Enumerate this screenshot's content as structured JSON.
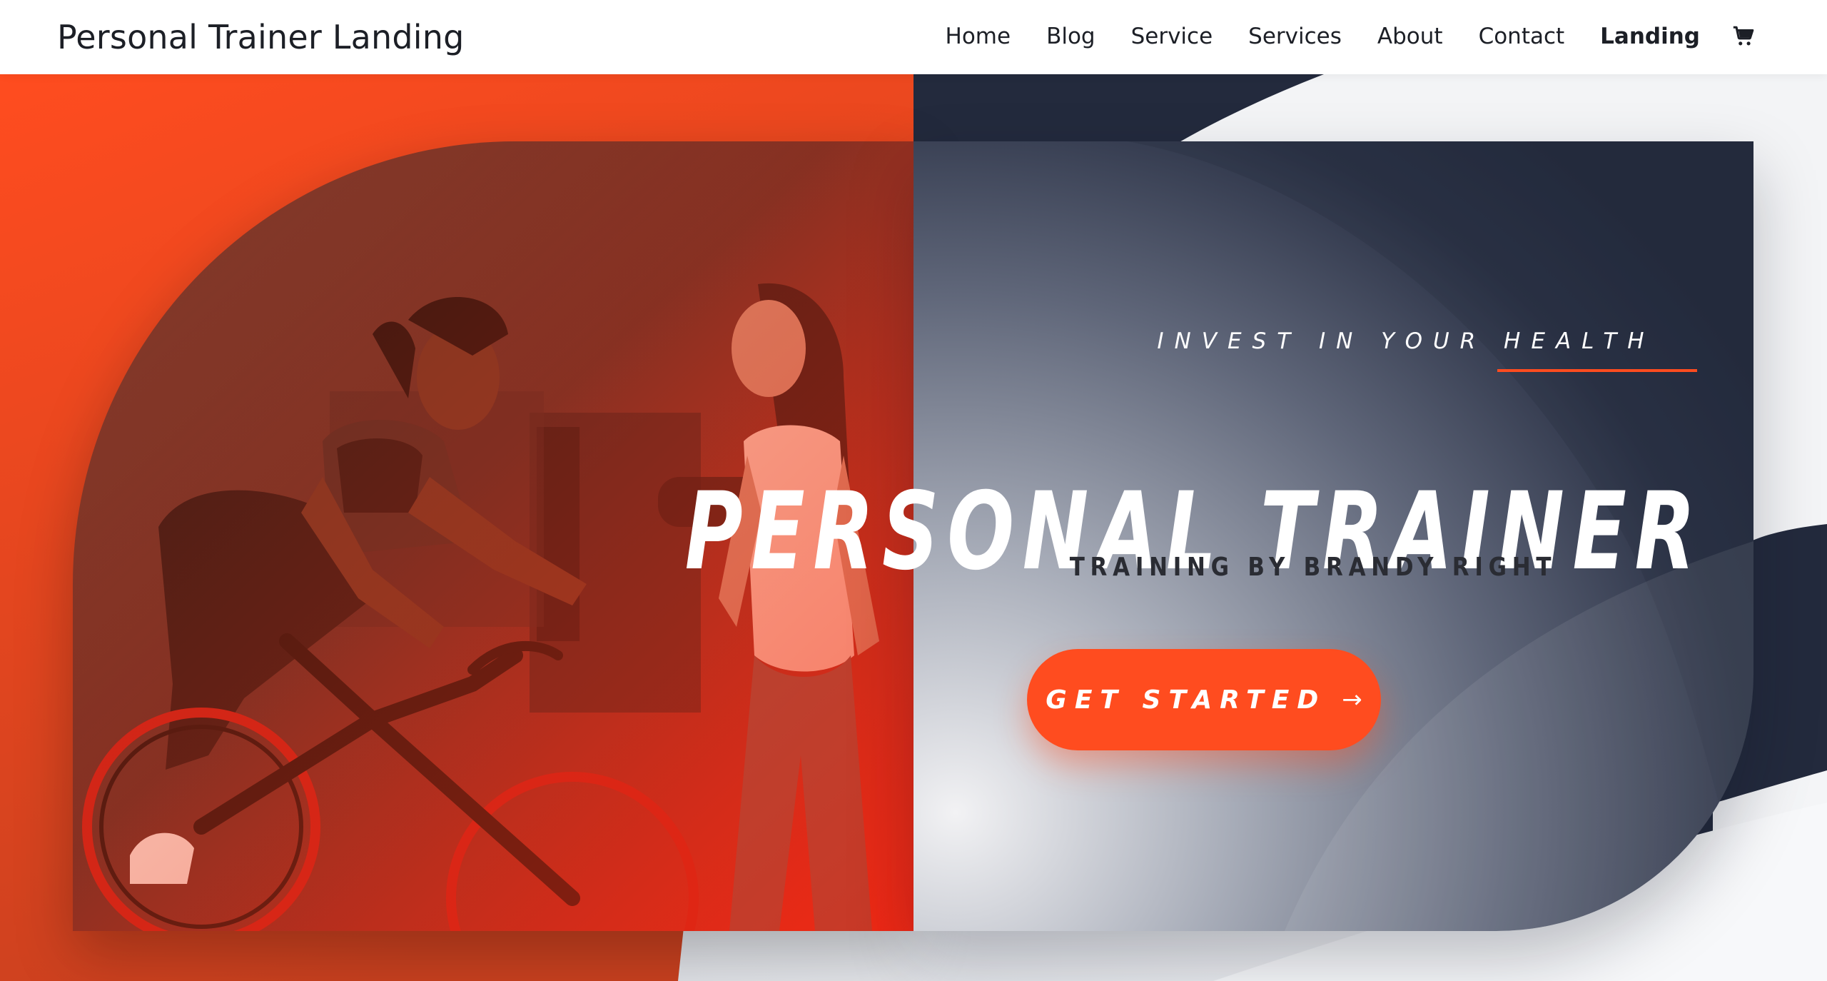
{
  "header": {
    "site_title": "Personal Trainer Landing",
    "nav": [
      {
        "label": "Home"
      },
      {
        "label": "Blog"
      },
      {
        "label": "Service"
      },
      {
        "label": "Services"
      },
      {
        "label": "About"
      },
      {
        "label": "Contact"
      },
      {
        "label": "Landing",
        "active": true
      }
    ],
    "cart_icon": "shopping-cart-icon"
  },
  "hero": {
    "eyebrow": "INVEST IN YOUR HEALTH",
    "headline": "PERSONAL TRAINER",
    "subhead": "TRAINING BY BRANDY RIGHT",
    "cta_label": "GET STARTED",
    "cta_icon": "arrow-right-icon",
    "cta_arrow": "→",
    "photo_description_icon": "trainer-photo",
    "colors": {
      "accent": "#ff4c1f",
      "navy": "#232a3d",
      "text_dark": "#1c1f26"
    }
  }
}
